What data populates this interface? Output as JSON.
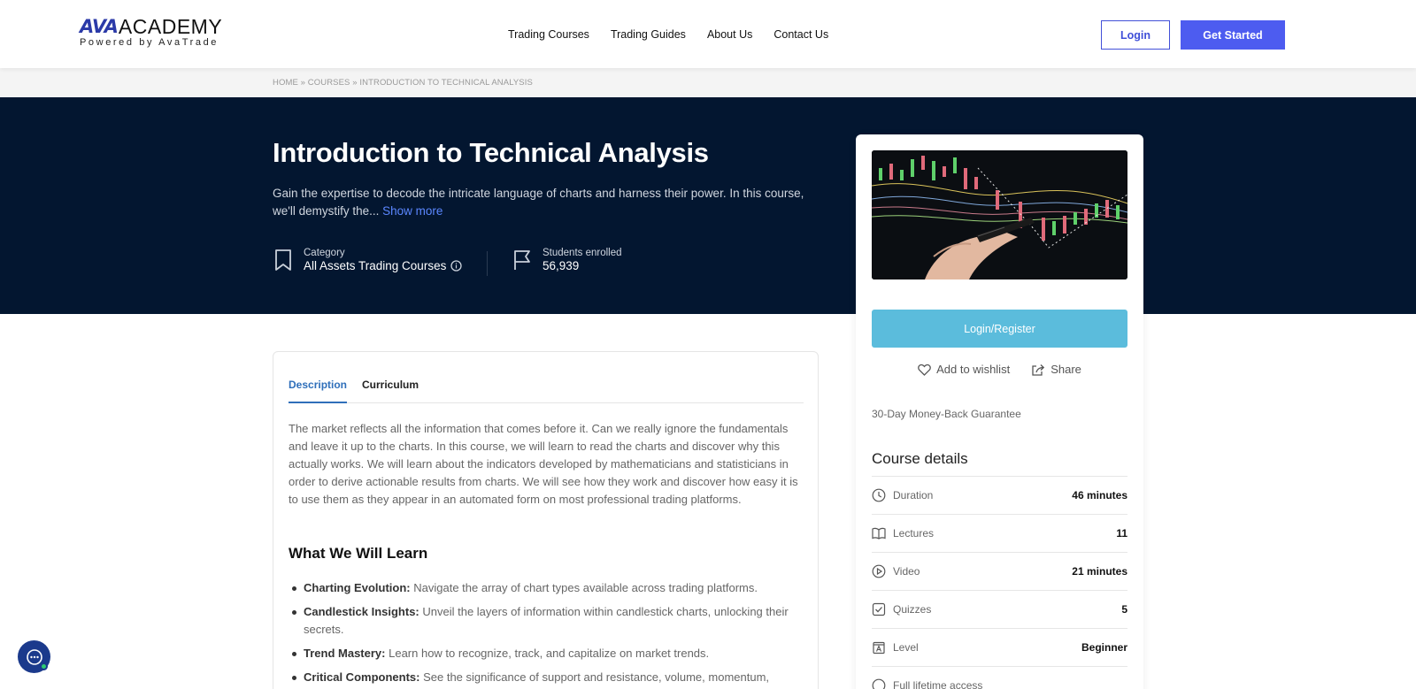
{
  "header": {
    "logo_ava": "AVA",
    "logo_academy": "ACADEMY",
    "logo_sub": "Powered by AvaTrade",
    "nav": [
      "Trading Courses",
      "Trading Guides",
      "About Us",
      "Contact Us"
    ],
    "login_label": "Login",
    "get_started_label": "Get Started"
  },
  "breadcrumb": {
    "home": "HOME",
    "sep": "»",
    "courses": "COURSES",
    "current": "INTRODUCTION TO TECHNICAL ANALYSIS"
  },
  "hero": {
    "title": "Introduction to Technical Analysis",
    "description": "Gain the expertise to decode the intricate language of charts and harness their power. In this course, we'll demystify the...",
    "show_more": "Show more",
    "category_label": "Category",
    "category_value": "All Assets Trading Courses",
    "students_label": "Students enrolled",
    "students_value": "56,939"
  },
  "card": {
    "register_label": "Login/Register",
    "wishlist_label": "Add to wishlist",
    "share_label": "Share",
    "guarantee": "30-Day Money-Back Guarantee",
    "details_title": "Course details",
    "details": [
      {
        "icon": "clock-icon",
        "label": "Duration",
        "value": "46 minutes"
      },
      {
        "icon": "book-icon",
        "label": "Lectures",
        "value": "11"
      },
      {
        "icon": "play-icon",
        "label": "Video",
        "value": "21 minutes"
      },
      {
        "icon": "checkbox-icon",
        "label": "Quizzes",
        "value": "5"
      },
      {
        "icon": "level-icon",
        "label": "Level",
        "value": "Beginner"
      },
      {
        "icon": "infinity-icon",
        "label": "Full lifetime access",
        "value": ""
      }
    ]
  },
  "content": {
    "tabs": [
      "Description",
      "Curriculum"
    ],
    "body": "The market reflects all the information that comes before it. Can we really ignore the fundamentals and leave it up to the charts. In this course, we will learn to read the charts and discover why this actually works.  We will learn about the indicators developed by mathematicians and statisticians in order to derive actionable results from charts. We will see how they work and discover how easy it is to use them as they appear in an automated form on most professional trading platforms.",
    "learn_title": "What We Will Learn",
    "learn_items": [
      {
        "title": "Charting Evolution:",
        "text": "Navigate the array of chart types available across trading platforms."
      },
      {
        "title": "Candlestick Insights:",
        "text": "Unveil the layers of information within candlestick charts, unlocking their secrets."
      },
      {
        "title": "Trend Mastery:",
        "text": "Learn how to recognize, track, and capitalize on market trends."
      },
      {
        "title": "Critical Components:",
        "text": "See the significance of support and resistance, volume, momentum,"
      }
    ]
  },
  "colors": {
    "brand": "#4d5cf0",
    "hero_bg": "#031630",
    "register": "#5bbcdc",
    "tab_active": "#2f6fba"
  }
}
